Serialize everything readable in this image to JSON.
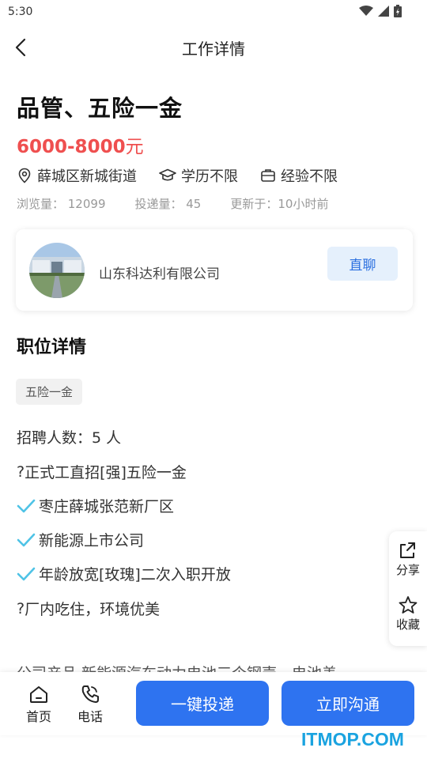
{
  "status": {
    "time": "5:30"
  },
  "nav": {
    "title": "工作详情"
  },
  "job": {
    "title": "品管、五险一金",
    "salary": "6000-8000",
    "salary_unit": "元",
    "tags": [
      "薛城区新城街道",
      "学历不限",
      "经验不限"
    ],
    "stats": [
      "浏览量：  12099",
      "投递量：  45",
      "更新于：10小时前"
    ]
  },
  "company": {
    "name": "山东科达利有限公司",
    "chat_label": "直聊"
  },
  "details": {
    "title": "职位详情",
    "benefit_chip": "五险一金",
    "recruit_count": "招聘人数：5 人",
    "lines": [
      {
        "prefix": "?",
        "text": "正式工直招[强]五险一金",
        "check": false
      },
      {
        "prefix": "",
        "text": "枣庄薛城张范新厂区",
        "check": true
      },
      {
        "prefix": "",
        "text": "新能源上市公司",
        "check": true
      },
      {
        "prefix": "",
        "text": "年龄放宽[玫瑰]二次入职开放",
        "check": true
      },
      {
        "prefix": "?",
        "text": "厂内吃住，环境优美",
        "check": false
      }
    ],
    "cut_text": "     公司产品 新能源汽车动力电池三个钢壳，电池盖"
  },
  "float": {
    "share": "分享",
    "favorite": "收藏"
  },
  "bottom": {
    "home": "首页",
    "phone": "电话",
    "apply": "一键投递",
    "contact": "立即沟通"
  },
  "watermark": "ITMOP.COM",
  "colors": {
    "accent": "#2e73f0",
    "salary": "#ef4f4f",
    "check": "#4fc3e6"
  }
}
